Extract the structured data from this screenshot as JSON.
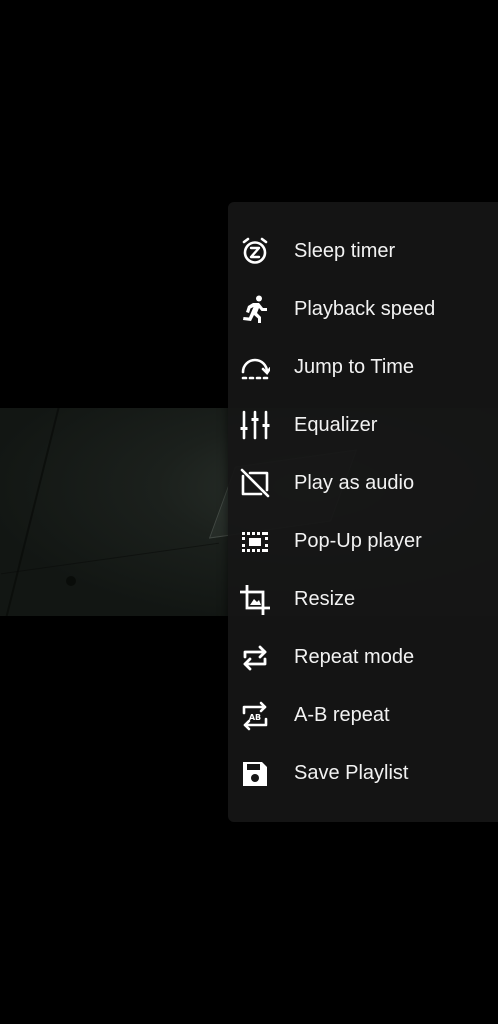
{
  "menu": {
    "items": [
      {
        "label": "Sleep timer",
        "icon": "alarm-snooze-icon"
      },
      {
        "label": "Playback speed",
        "icon": "running-person-icon"
      },
      {
        "label": "Jump to Time",
        "icon": "jump-arc-icon"
      },
      {
        "label": "Equalizer",
        "icon": "equalizer-sliders-icon"
      },
      {
        "label": "Play as audio",
        "icon": "video-off-icon"
      },
      {
        "label": "Pop-Up player",
        "icon": "picture-in-picture-icon"
      },
      {
        "label": "Resize",
        "icon": "crop-icon"
      },
      {
        "label": "Repeat mode",
        "icon": "repeat-icon"
      },
      {
        "label": "A-B repeat",
        "icon": "ab-repeat-icon"
      },
      {
        "label": "Save Playlist",
        "icon": "save-floppy-icon"
      }
    ]
  },
  "colors": {
    "menu_background": "#161616",
    "text": "#f2f2f2",
    "icon": "#ffffff"
  }
}
